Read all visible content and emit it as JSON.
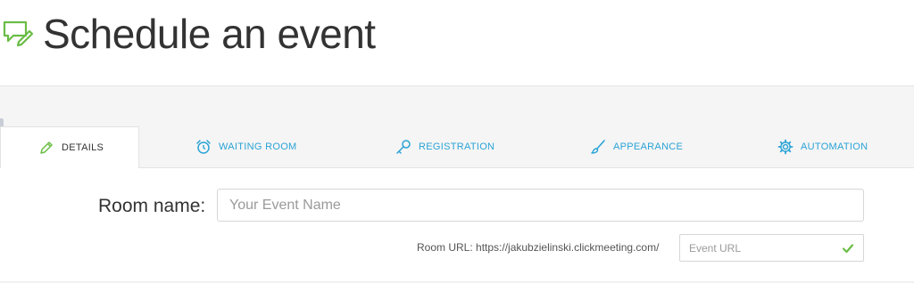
{
  "page": {
    "title": "Schedule an event",
    "icon": "chat-edit-icon"
  },
  "tabs": [
    {
      "label": "DETAILS",
      "icon": "pencil-icon",
      "active": true
    },
    {
      "label": "WAITING ROOM",
      "icon": "alarm-clock-icon",
      "active": false
    },
    {
      "label": "REGISTRATION",
      "icon": "key-icon",
      "active": false
    },
    {
      "label": "APPEARANCE",
      "icon": "brush-icon",
      "active": false
    },
    {
      "label": "AUTOMATION",
      "icon": "gear-icon",
      "active": false
    }
  ],
  "form": {
    "room_name_label": "Room name:",
    "room_name_value": "",
    "room_name_placeholder": "Your Event Name",
    "room_url_label": "Room URL: https://jakubzielinski.clickmeeting.com/",
    "event_url_value": "",
    "event_url_placeholder": "Event URL",
    "valid_icon": "check-icon"
  },
  "colors": {
    "accent": "#2aa3d6",
    "brand_green": "#6abd45",
    "check_green": "#6abd45",
    "panel_bg": "#f5f5f5",
    "text": "#333333"
  }
}
